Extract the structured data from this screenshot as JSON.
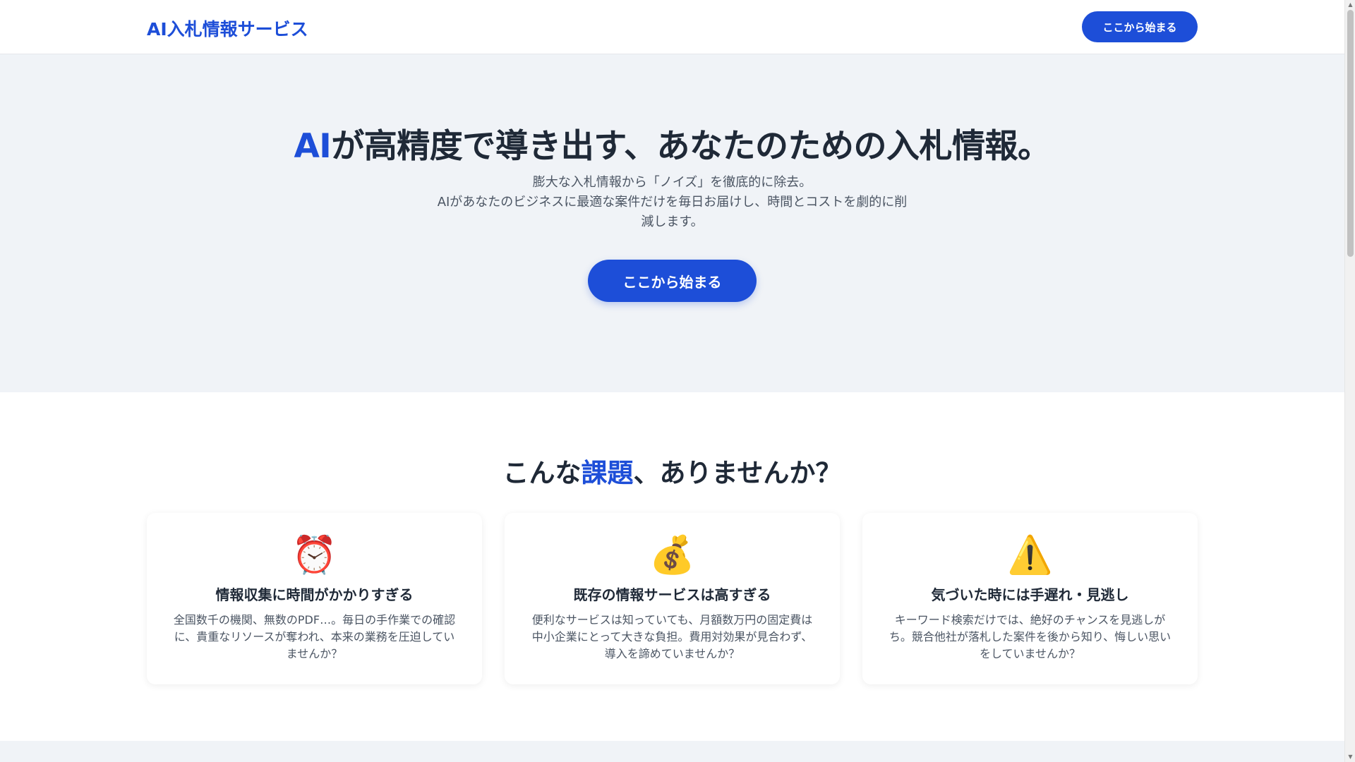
{
  "header": {
    "logo": "AI入札情報サービス",
    "cta_label": "ここから始まる"
  },
  "hero": {
    "title_accent": "AI",
    "title_rest": "が高精度で導き出す、あなたのための入札情報。",
    "subtitle_line1": "膨大な入札情報から「ノイズ」を徹底的に除去。",
    "subtitle_line2": "AIがあなたのビジネスに最適な案件だけを毎日お届けし、時間とコストを劇的に削減します。",
    "cta_label": "ここから始まる"
  },
  "problems": {
    "title_pre": "こんな",
    "title_accent": "課題",
    "title_post": "、ありませんか？",
    "cards": [
      {
        "icon": "alarm-clock-icon",
        "icon_glyph": "⏰",
        "title": "情報収集に時間がかかりすぎる",
        "desc": "全国数千の機関、無数のPDF…。毎日の手作業での確認に、貴重なリソースが奪われ、本来の業務を圧迫していませんか？"
      },
      {
        "icon": "money-bag-icon",
        "icon_glyph": "💰",
        "title": "既存の情報サービスは高すぎる",
        "desc": "便利なサービスは知っていても、月額数万円の固定費は中小企業にとって大きな負担。費用対効果が見合わず、導入を諦めていませんか？"
      },
      {
        "icon": "warning-icon",
        "icon_glyph": "⚠️",
        "title": "気づいた時には手遅れ・見逃し",
        "desc": "キーワード検索だけでは、絶好のチャンスを見逃しがち。競合他社が落札した案件を後から知り、悔しい思いをしていませんか？"
      }
    ]
  },
  "colors": {
    "accent": "#1d4ed8",
    "hero_bg": "#f0f3f7",
    "text": "#1f2937"
  }
}
